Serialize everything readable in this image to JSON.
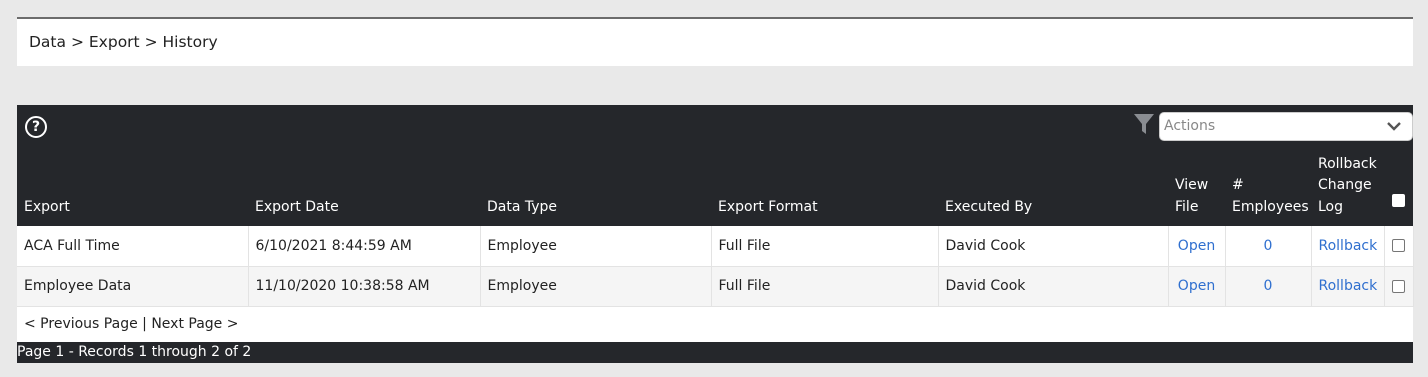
{
  "breadcrumb": {
    "items": [
      "Data",
      "Export",
      "History"
    ],
    "separator": ">"
  },
  "toolbar": {
    "help_glyph": "?",
    "filter_icon": "filter-icon",
    "actions_placeholder": "Actions"
  },
  "table": {
    "columns": [
      "Export",
      "Export Date",
      "Data Type",
      "Export Format",
      "Executed By",
      "View File",
      "# Employees",
      "Rollback Change Log"
    ],
    "header_lines": {
      "view_file": [
        "View",
        "File"
      ],
      "employees": [
        "#",
        "Employees"
      ],
      "rollback": [
        "Rollback",
        "Change",
        "Log"
      ]
    },
    "rows": [
      {
        "export": "ACA Full Time",
        "export_date": "6/10/2021 8:44:59 AM",
        "data_type": "Employee",
        "export_format": "Full File",
        "executed_by": "David Cook",
        "view_file": "Open",
        "employees": "0",
        "rollback": "Rollback"
      },
      {
        "export": "Employee Data",
        "export_date": "11/10/2020 10:38:58 AM",
        "data_type": "Employee",
        "export_format": "Full File",
        "executed_by": "David Cook",
        "view_file": "Open",
        "employees": "0",
        "rollback": "Rollback"
      }
    ]
  },
  "pager": {
    "previous": "< Previous Page",
    "divider": "|",
    "next": "Next Page >"
  },
  "footer": {
    "status": "Page 1 - Records 1 through 2 of 2"
  },
  "colors": {
    "header_bg": "#25272b",
    "link": "#2f6fcf",
    "page_bg": "#e9e9e9"
  }
}
